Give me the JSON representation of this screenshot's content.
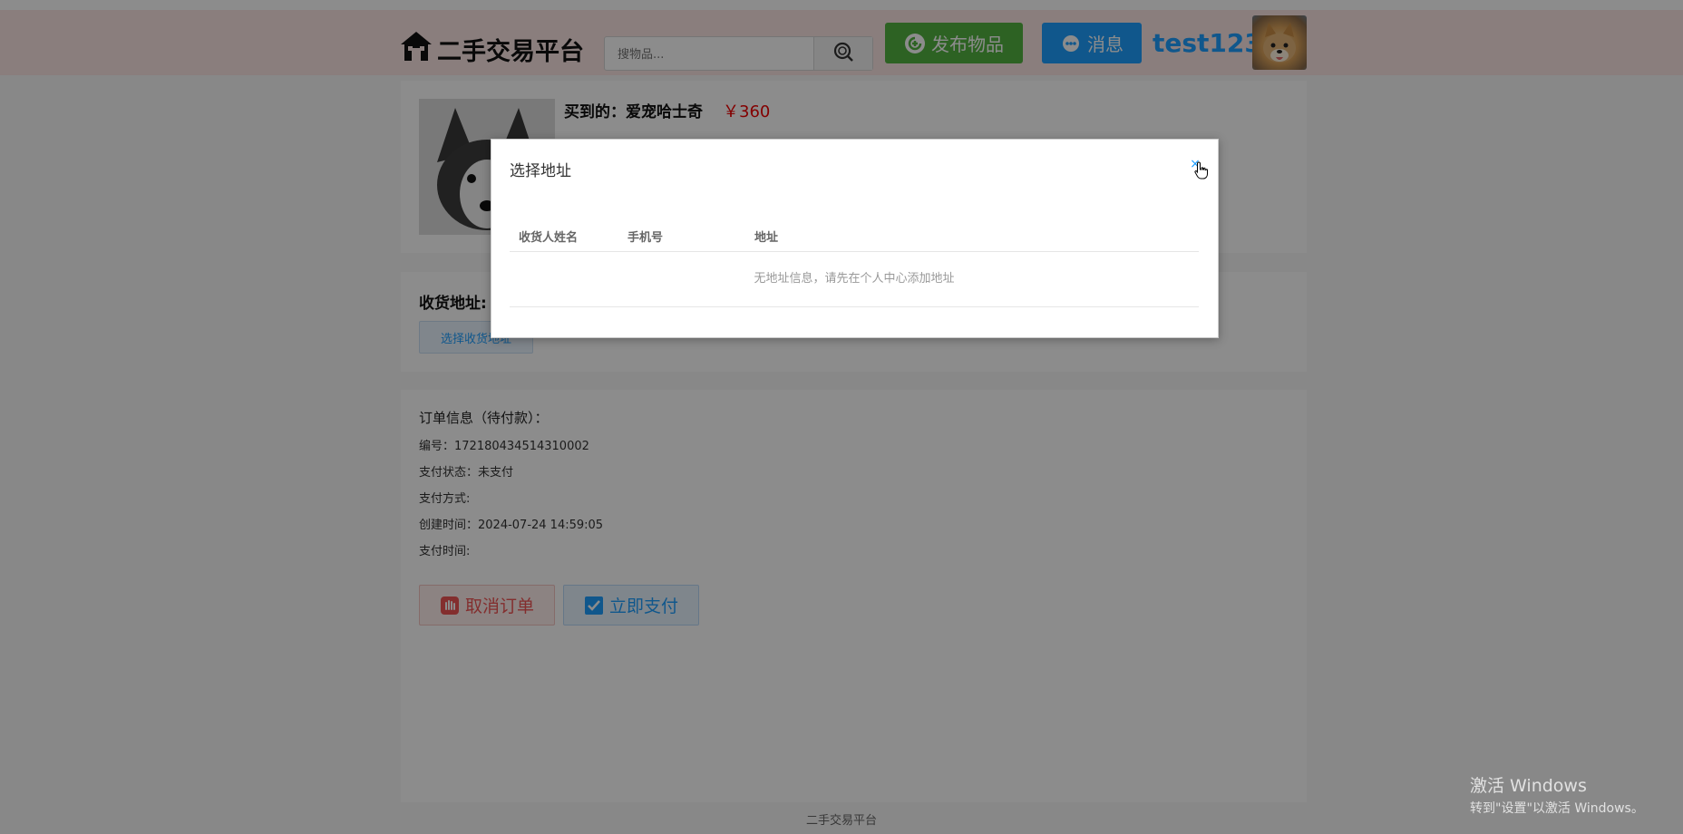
{
  "header": {
    "logo_text": "二手交易平台",
    "search_placeholder": "搜物品...",
    "publish_label": "发布物品",
    "message_label": "消息",
    "username": "test123"
  },
  "product": {
    "title": "买到的：爱宠哈士奇",
    "price": "￥360"
  },
  "address": {
    "label": "收货地址:",
    "select_button": "选择收货地址"
  },
  "order": {
    "heading": "订单信息（待付款）：",
    "number": "编号：172180434514310002",
    "pay_status": "支付状态：未支付",
    "pay_method": "支付方式:",
    "created": "创建时间：2024-07-24 14:59:05",
    "pay_time": "支付时间:",
    "cancel_label": "取消订单",
    "pay_label": "立即支付"
  },
  "footer": {
    "text": "二手交易平台"
  },
  "modal": {
    "title": "选择地址",
    "close": "×",
    "columns": [
      "收货人姓名",
      "手机号",
      "地址"
    ],
    "empty_text": "无地址信息，请先在个人中心添加地址"
  },
  "watermark": {
    "line1": "激活 Windows",
    "line2": "转到\"设置\"以激活 Windows。"
  },
  "colors": {
    "header_bg": "#fbe5e3",
    "publish_green": "#52b340",
    "message_blue": "#1e9fff",
    "price_red": "#e00000"
  }
}
